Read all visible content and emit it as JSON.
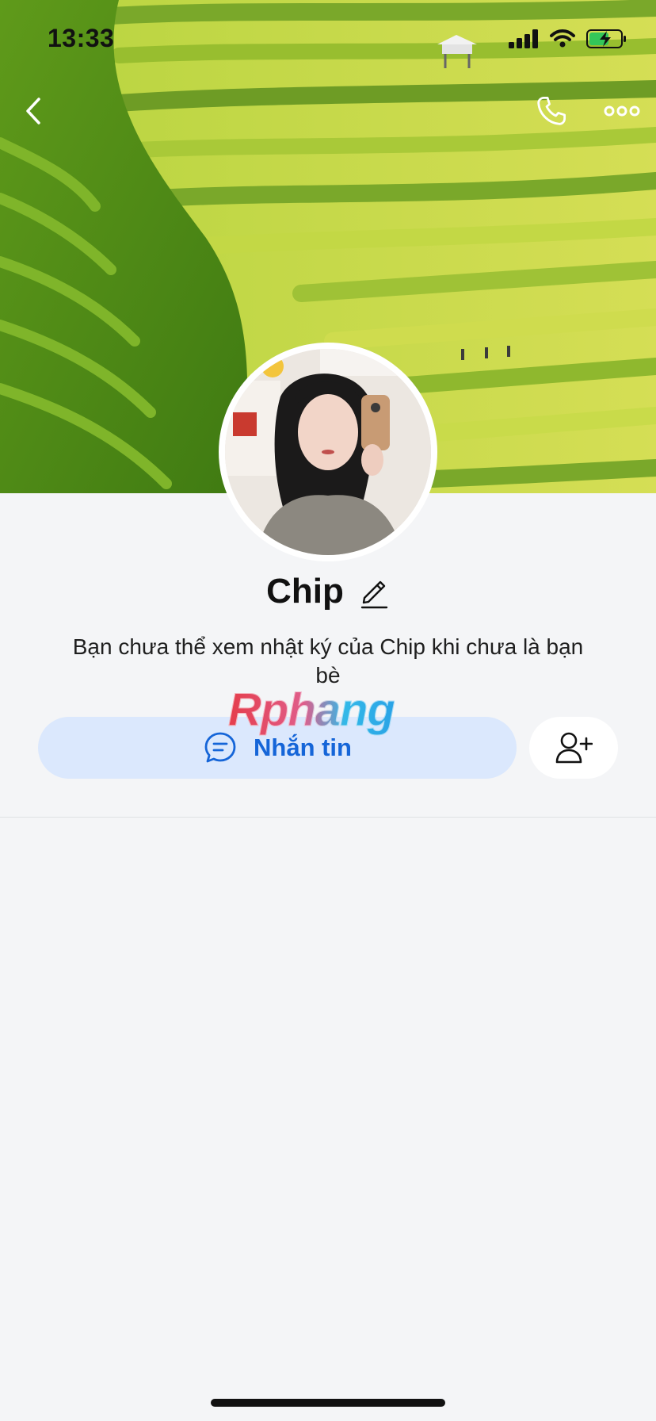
{
  "status_bar": {
    "time": "13:33"
  },
  "icons": {
    "back": "chevron-left-icon",
    "call": "phone-icon",
    "more": "ellipsis-icon",
    "edit": "pencil-icon",
    "message": "chat-bubble-icon",
    "add_friend": "add-user-icon"
  },
  "profile": {
    "name": "Chip",
    "notice": "Bạn chưa thể xem nhật ký của Chip khi chưa là bạn bè"
  },
  "watermark": "Rphang",
  "actions": {
    "message_label": "Nhắn tin"
  },
  "colors": {
    "accent": "#1565d8",
    "message_button_bg": "#dbe8fd",
    "background": "#f4f5f7",
    "battery_fill": "#34c759"
  }
}
